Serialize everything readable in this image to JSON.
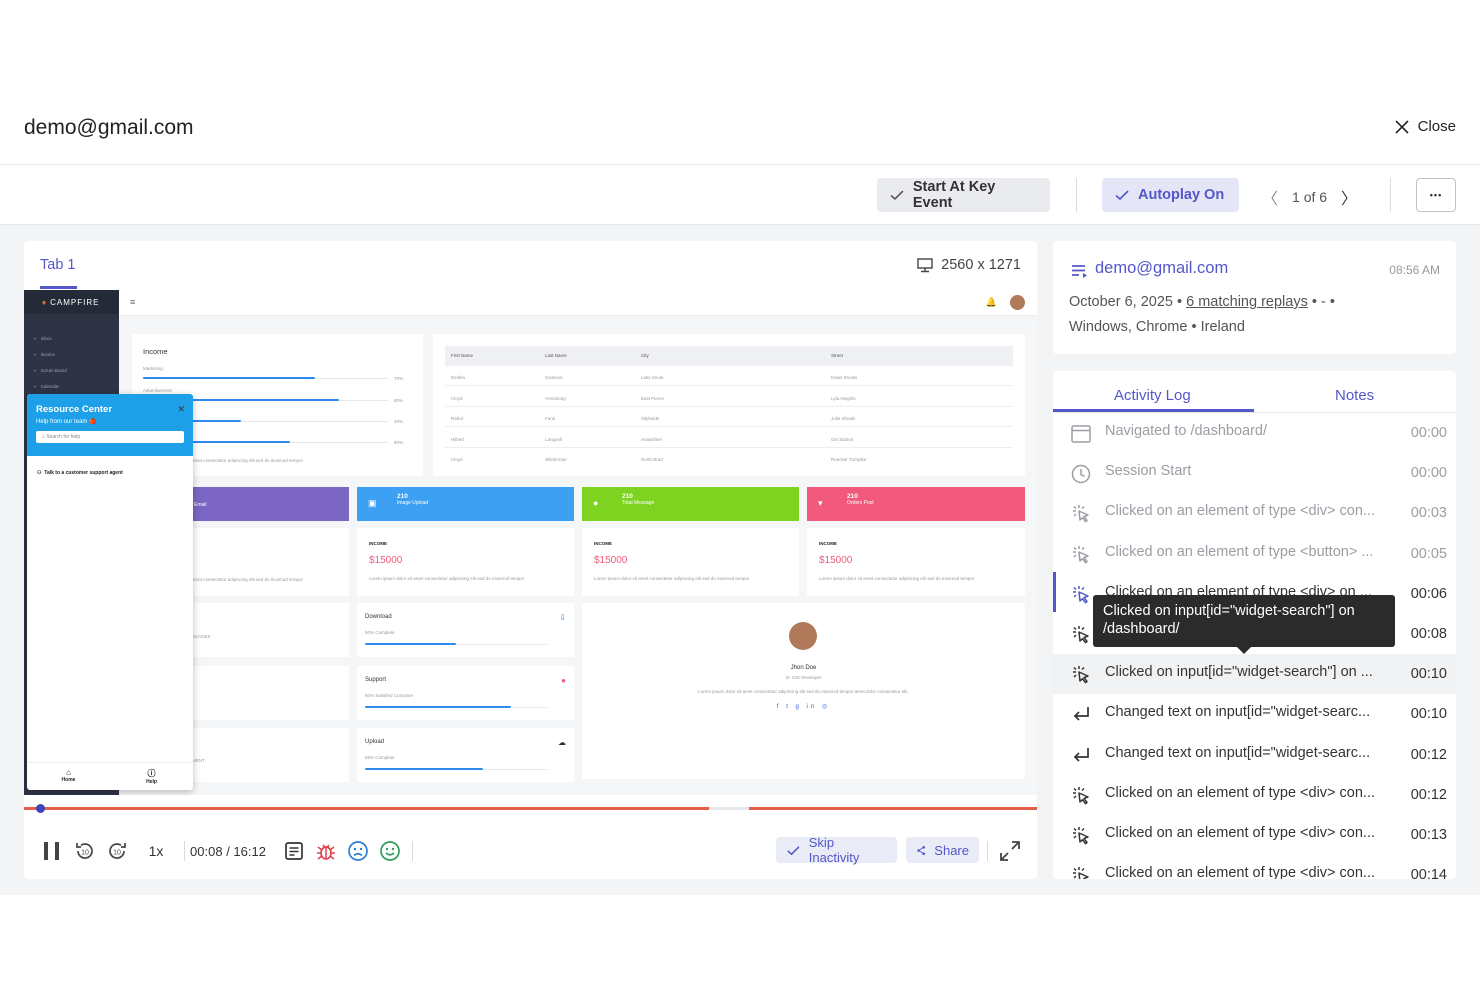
{
  "header": {
    "email": "demo@gmail.com",
    "close_label": "Close"
  },
  "toolbar": {
    "start_key_event": "Start At Key Event",
    "autoplay": "Autoplay On",
    "pager": "1 of 6",
    "more": "•••"
  },
  "player": {
    "tab_label": "Tab 1",
    "resolution": "2560 x 1271",
    "time": "00:08 / 16:12",
    "speed": "1x",
    "skip_inactivity": "Skip Inactivity",
    "share": "Share",
    "progress": 0.008
  },
  "replay": {
    "logo": "CAMPFIRE",
    "sidebar": [
      "Inbox",
      "Invoice",
      "Scrum Board",
      "Calendar"
    ],
    "income_title": "Income",
    "income_rows": [
      {
        "label": "Marketing",
        "pct": "70%"
      },
      {
        "label": "Advertisement",
        "pct": "80%"
      },
      {
        "label": "",
        "pct": "40%"
      },
      {
        "label": "",
        "pct": "60%"
      }
    ],
    "table_headers": [
      "First Name",
      "Last Name",
      "City",
      "Street"
    ],
    "table_rows": [
      [
        "Emelia",
        "Gislason",
        "Lake Zeola",
        "Kulas Shoals"
      ],
      [
        "Cloyd",
        "Armstrong",
        "East Pierce",
        "Lyla Heights"
      ],
      [
        "Rahul",
        "Funk",
        "Silphside",
        "Jolie Shoals"
      ],
      [
        "Hilbert",
        "Langosh",
        "Anaisshire",
        "Gin Station"
      ],
      [
        "Cloyd",
        "Wilderman",
        "North Brad",
        "Ruecker Turnpike"
      ]
    ],
    "tiles": [
      {
        "value": "",
        "label": "Email",
        "color": "#7b66c4"
      },
      {
        "value": "210",
        "label": "Image Upload",
        "color": "#3ea0f2"
      },
      {
        "value": "210",
        "label": "Total Message",
        "color": "#7ed321"
      },
      {
        "value": "210",
        "label": "Orders Post",
        "color": "#f25a7d"
      }
    ],
    "income_card": {
      "title": "INCOME",
      "value": "$15000",
      "desc": "Lorem ipsum dolor sit amet consectetur adipiscing elit sed do eiusmod tempor"
    },
    "lorem": "amet consectetur adipiscing elit sed do eiusmod tempor",
    "messages_frag": "SSAGES",
    "ment_frag": "MENT",
    "stats": [
      {
        "title": "Download",
        "sub": "50% Complete",
        "fill": 0.5
      },
      {
        "title": "Support",
        "sub": "80% Satisfied Customer",
        "fill": 0.8
      },
      {
        "title": "Upload",
        "sub": "65% Complete",
        "fill": 0.65
      }
    ],
    "profile": {
      "name": "Jhon Doe",
      "role": "Sr. iOS Developer",
      "bio": "Lorem ipsum dolor sit amet consectetur adipiscing elit sed do eiusmod tempor amet dolor consectetur elit."
    },
    "resource_center": {
      "title": "Resource Center",
      "subtitle": "Help from our team 🍎",
      "search": "Search for help",
      "agent": "Talk to a customer support agent",
      "home": "Home",
      "help": "Help"
    }
  },
  "info": {
    "email": "demo@gmail.com",
    "time": "08:56 AM",
    "date": "October 6, 2025 •",
    "replays_link": "6 matching replays",
    "dashes": "• - •",
    "system": "Windows, Chrome • Ireland"
  },
  "log": {
    "tab_activity": "Activity Log",
    "tab_notes": "Notes",
    "tooltip": "Clicked on input[id=\"widget-search\"] on /dashboard/",
    "rows": [
      {
        "icon": "window",
        "text": "Navigated to /dashboard/",
        "time": "00:00",
        "style": "dim"
      },
      {
        "icon": "clock",
        "text": "Session Start",
        "time": "00:00",
        "style": "dim"
      },
      {
        "icon": "click",
        "text": "Clicked on an element of type <div> con...",
        "time": "00:03",
        "style": "dim"
      },
      {
        "icon": "click",
        "text": "Clicked on an element of type <button> ...",
        "time": "00:05",
        "style": "dim"
      },
      {
        "icon": "click",
        "text": "Clicked on an element of type <div> on ...",
        "time": "00:06",
        "style": "dark"
      },
      {
        "icon": "click",
        "text": "",
        "time": "00:08",
        "style": "dark"
      },
      {
        "icon": "click",
        "text": "Clicked on input[id=\"widget-search\"] on ...",
        "time": "00:10",
        "style": "dark"
      },
      {
        "icon": "enter",
        "text": "Changed text on input[id=\"widget-searc...",
        "time": "00:10",
        "style": "dark"
      },
      {
        "icon": "enter",
        "text": "Changed text on input[id=\"widget-searc...",
        "time": "00:12",
        "style": "dark"
      },
      {
        "icon": "click",
        "text": "Clicked on an element of type <div> con...",
        "time": "00:12",
        "style": "dark"
      },
      {
        "icon": "click",
        "text": "Clicked on an element of type <div> con...",
        "time": "00:13",
        "style": "dark"
      },
      {
        "icon": "click",
        "text": "Clicked on an element of type <div> con...",
        "time": "00:14",
        "style": "dark"
      }
    ]
  },
  "colors": {
    "accent": "#5457c9",
    "progress": "#e35f4a",
    "bug": "#e0424d",
    "sad": "#2a7fd6",
    "happy": "#2e9e5b"
  }
}
